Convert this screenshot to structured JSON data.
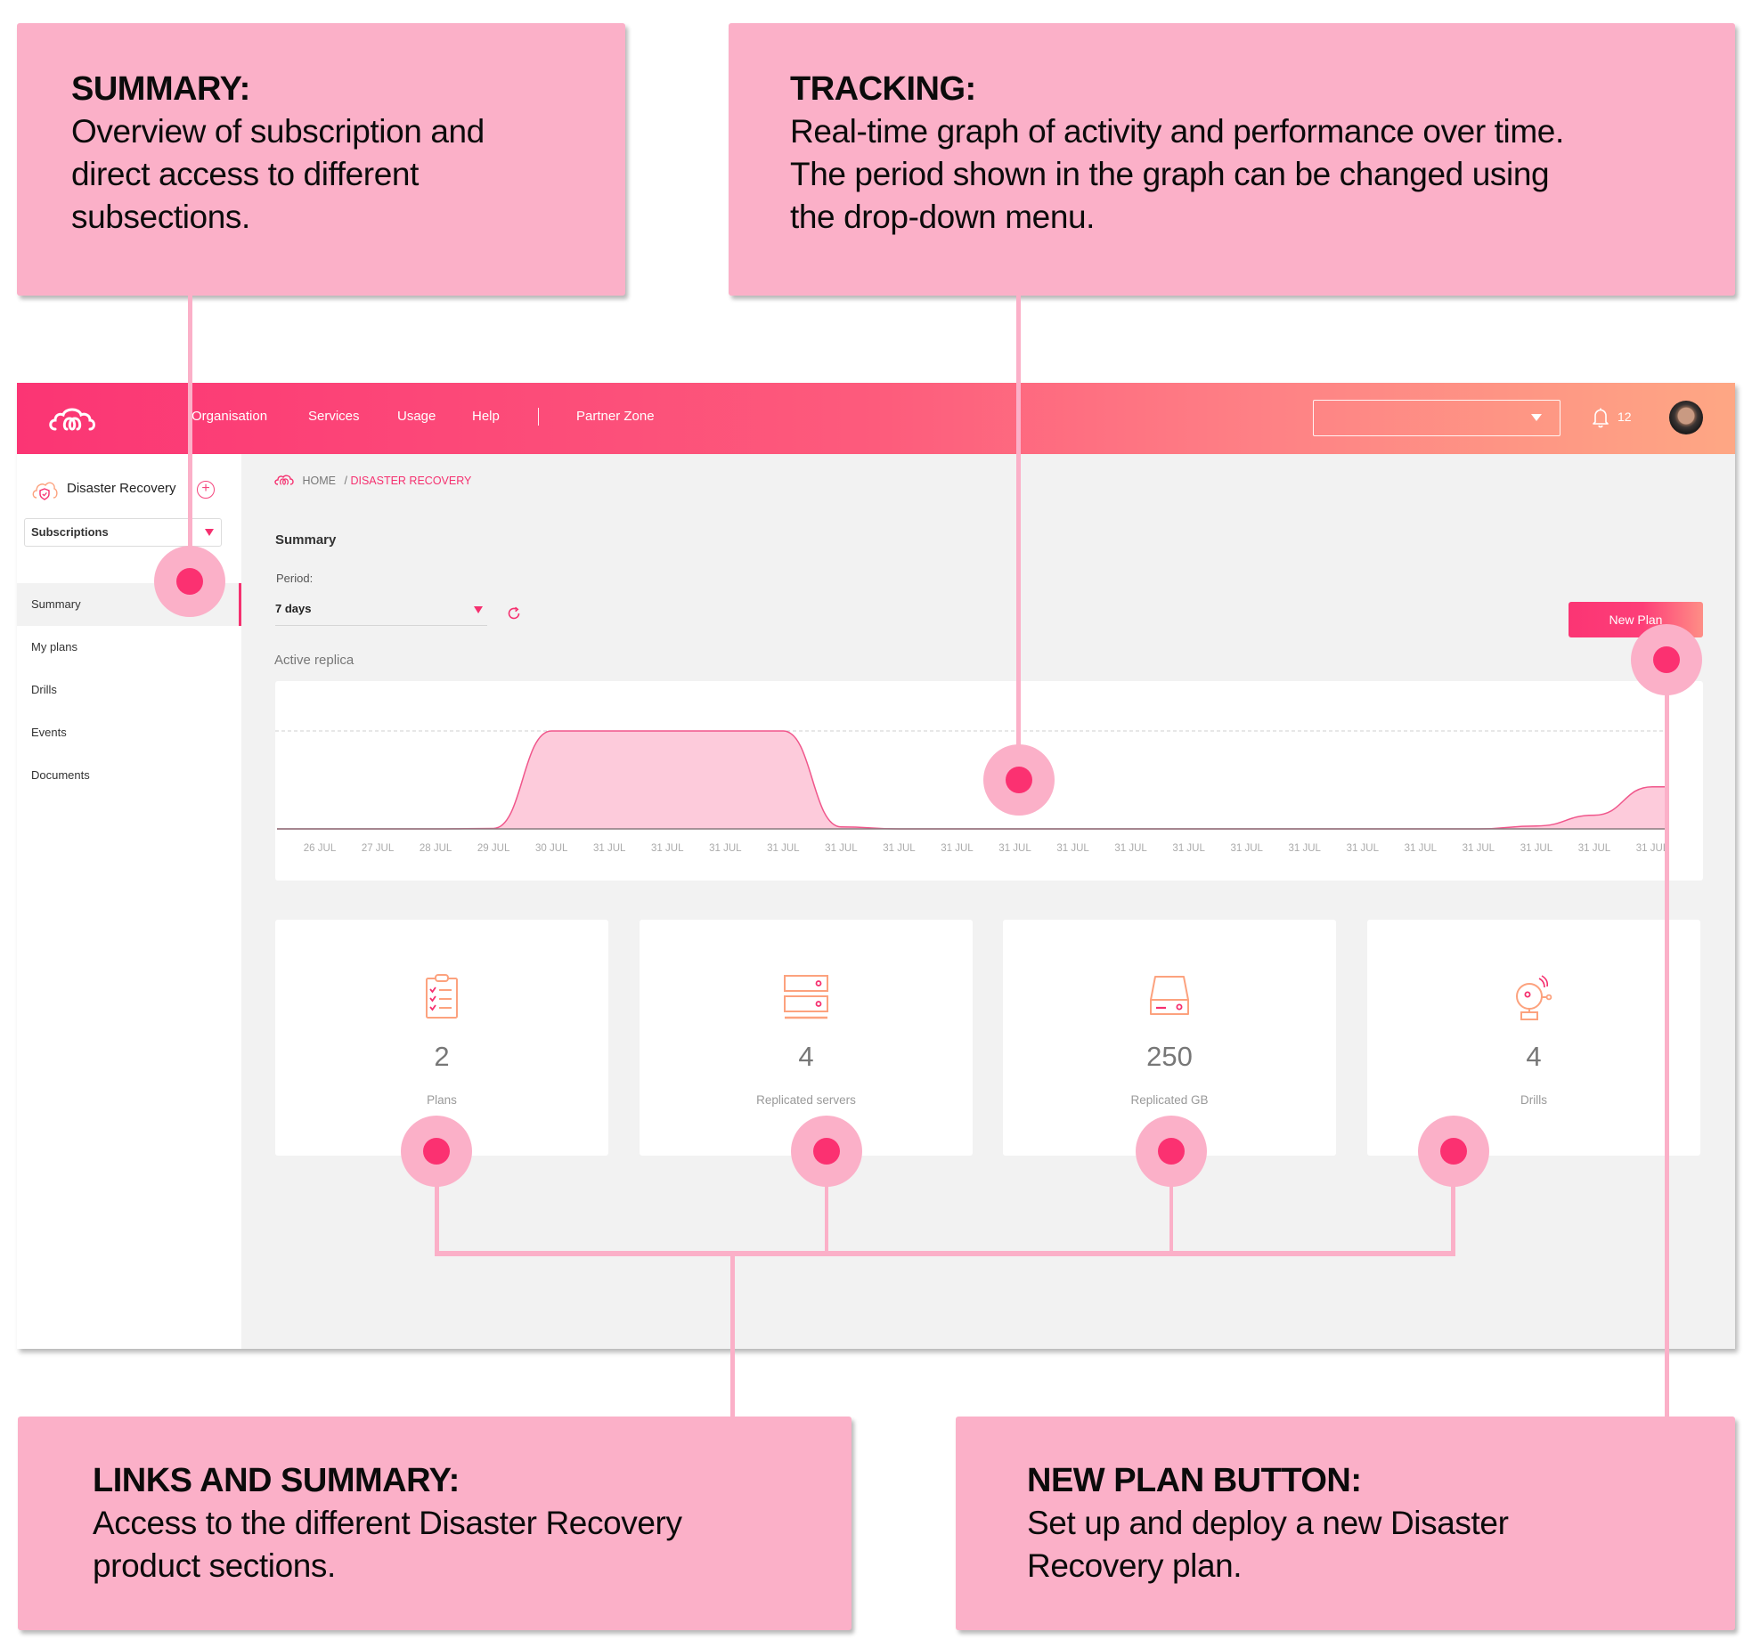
{
  "callouts": {
    "summary": {
      "title": "SUMMARY:",
      "body": [
        "Overview of subscription and",
        "direct access to different",
        "subsections."
      ]
    },
    "tracking": {
      "title": "TRACKING:",
      "body": [
        "Real-time graph of activity and performance over time.",
        "The period shown in the graph can be changed using",
        "the drop-down menu."
      ]
    },
    "links": {
      "title": "LINKS AND SUMMARY:",
      "body": [
        "Access to the different Disaster Recovery",
        "product sections."
      ]
    },
    "new_plan": {
      "title": "NEW PLAN BUTTON:",
      "body": [
        "Set up and deploy a new Disaster",
        "Recovery plan."
      ]
    }
  },
  "topbar": {
    "logo_icon": "cloud-logo-icon",
    "nav": [
      "Organisation",
      "Services",
      "Usage",
      "Help",
      "Partner Zone"
    ],
    "org_select_value": "",
    "notification_icon": "bell-icon",
    "notification_count": "12",
    "avatar": "user-avatar"
  },
  "sidebar": {
    "product_name": "Disaster Recovery",
    "product_icon": "cloud-shield-icon",
    "add_icon": "plus-circle-icon",
    "subscription_select": "Subscriptions",
    "items": [
      {
        "label": "Summary",
        "active": true
      },
      {
        "label": "My plans",
        "active": false
      },
      {
        "label": "Drills",
        "active": false
      },
      {
        "label": "Events",
        "active": false
      },
      {
        "label": "Documents",
        "active": false
      }
    ]
  },
  "main": {
    "breadcrumb": {
      "home": "HOME",
      "separator": "/",
      "current": "DISASTER RECOVERY"
    },
    "title": "Summary",
    "period_label": "Period:",
    "period_value": "7 days",
    "refresh_icon": "refresh-icon",
    "new_plan_label": "New Plan",
    "chart_title": "Active replica",
    "stats": [
      {
        "icon": "clipboard-checklist-icon",
        "value": "2",
        "label": "Plans"
      },
      {
        "icon": "server-stack-icon",
        "value": "4",
        "label": "Replicated servers"
      },
      {
        "icon": "hard-drive-icon",
        "value": "250",
        "label": "Replicated GB"
      },
      {
        "icon": "alarm-bell-icon",
        "value": "4",
        "label": "Drills"
      }
    ]
  },
  "colors": {
    "accent": "#f5306f",
    "callout_bg": "#fbb0c8",
    "marker_outer": "#fbb0c8",
    "marker_inner": "#fb3171",
    "chart_fill": "#fdcbdb",
    "chart_line": "#f0568b",
    "icon_orange": "#fca27e"
  },
  "chart_data": {
    "type": "area",
    "title": "Active replica",
    "xlabel": "",
    "ylabel": "",
    "categories": [
      "26 JUL",
      "27 JUL",
      "28 JUL",
      "29 JUL",
      "30 JUL",
      "31 JUL",
      "31 JUL",
      "31 JUL",
      "31 JUL",
      "31 JUL",
      "31 JUL",
      "31 JUL",
      "31 JUL",
      "31 JUL",
      "31 JUL",
      "31 JUL",
      "31 JUL",
      "31 JUL",
      "31 JUL",
      "31 JUL",
      "31 JUL",
      "31 JUL",
      "31 JUL",
      "31 JUL"
    ],
    "values": [
      0,
      0,
      0,
      0.5,
      100,
      100,
      100,
      100,
      100,
      2,
      0,
      0,
      0,
      0,
      0,
      0,
      0,
      0,
      0,
      0,
      0,
      3,
      14,
      43
    ],
    "max_reference_line": 100,
    "ylim": [
      0,
      100
    ],
    "grid": false,
    "legend": "none"
  }
}
